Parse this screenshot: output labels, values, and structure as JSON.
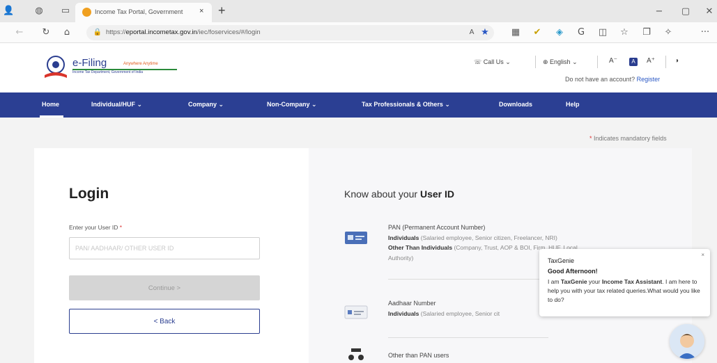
{
  "browser": {
    "tab_title": "Income Tax Portal, Government",
    "tab_close": "×",
    "new_tab": "+",
    "url_prefix": "https://",
    "url_domain": "eportal.incometax.gov.in",
    "url_path": "/iec/foservices/#/login",
    "window_minimize": "−",
    "window_restore": "▢",
    "window_close": "✕",
    "menu_dots": "···"
  },
  "header": {
    "logo_text": "e-Filing",
    "logo_tagline": "Anywhere Anytime",
    "logo_subtitle": "Income Tax Department, Government of India",
    "call_us": "Call Us",
    "language": "English",
    "font_smaller": "A⁻",
    "font_normal": "A",
    "font_larger": "A⁺",
    "contrast": "◑",
    "no_account": "Do not have an account?",
    "register": "Register"
  },
  "nav": {
    "items": [
      {
        "label": "Home"
      },
      {
        "label": "Individual/HUF ⌄"
      },
      {
        "label": "Company ⌄"
      },
      {
        "label": "Non-Company ⌄"
      },
      {
        "label": "Tax Professionals & Others ⌄"
      },
      {
        "label": "Downloads"
      },
      {
        "label": "Help"
      }
    ]
  },
  "main": {
    "mandatory_star": "*",
    "mandatory_text": "Indicates mandatory fields",
    "login_title": "Login",
    "userid_label": "Enter your User ID",
    "userid_required": "*",
    "userid_placeholder": "PAN/ AADHAAR/ OTHER USER ID",
    "userid_value": "",
    "continue_label": "Continue  >",
    "back_label": "< Back"
  },
  "know": {
    "title_prefix": "Know about your",
    "title_bold": "User ID",
    "items": [
      {
        "title": "PAN (Permanent Account Number)",
        "line1_bold": "Individuals",
        "line1_rest": " (Salaried employee, Senior citizen, Freelancer, NRI)",
        "line2_bold": "Other Than Individuals",
        "line2_rest": " (Company, Trust, AOP & BOI, Firm, HUF, Local",
        "line3": "Authority)"
      },
      {
        "title": "Aadhaar Number",
        "line1_bold": "Individuals",
        "line1_rest": " (Salaried employee, Senior cit"
      },
      {
        "title": "Other than PAN users"
      }
    ]
  },
  "genie": {
    "close": "×",
    "name": "TaxGenie",
    "greeting": "Good Afternoon!",
    "msg_1": "I am ",
    "msg_bold_1": "TaxGenie",
    "msg_2": " your ",
    "msg_bold_2": "Income Tax Assistant",
    "msg_3": ". I am here to help you with your tax related queries.What would you like to do?"
  },
  "colors": {
    "brand_blue": "#2b3f93",
    "link_blue": "#2a58c4",
    "required_red": "#d33333"
  }
}
